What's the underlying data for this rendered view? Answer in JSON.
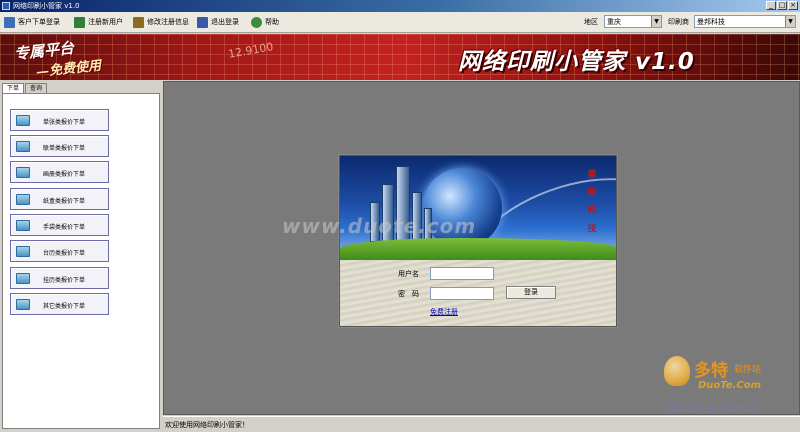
{
  "window": {
    "title": "网络印刷小管家 v1.0",
    "buttons": [
      "_",
      "□",
      "×"
    ]
  },
  "toolbar": {
    "items": [
      {
        "label": "客户下单登录",
        "icon": "client-login-icon",
        "color": "#3b6fb6"
      },
      {
        "label": "注册新用户",
        "icon": "new-user-icon",
        "color": "#2f7f3a"
      },
      {
        "label": "修改注册信息",
        "icon": "edit-info-icon",
        "color": "#8a6b1f"
      },
      {
        "label": "退出登录",
        "icon": "logout-icon",
        "color": "#3a58a8"
      },
      {
        "label": "帮助",
        "icon": "help-icon",
        "color": "#3c8c3c"
      }
    ],
    "region_label": "地区",
    "region_value": "重庆",
    "printer_label": "印刷商",
    "printer_value": "曼邦科技"
  },
  "banner": {
    "slogan_line1": "专属平台",
    "slogan_line2": "—免费使用",
    "deco_text": "12.9100",
    "app_title": "网络印刷小管家 v1.0"
  },
  "left_panel": {
    "tabs": [
      "下单",
      "查询"
    ],
    "items": [
      "单张类报价下单",
      "联单类报价下单",
      "画册类报价下单",
      "纸盒类报价下单",
      "手袋类报价下单",
      "台历类报价下单",
      "挂历类报价下单",
      "其它类报价下单"
    ]
  },
  "login": {
    "brand_vertical": "曼 邦 科 技",
    "watermark": "www.duote.com",
    "username_label": "用户名",
    "username_value": "",
    "password_label": "密　码",
    "password_value": "",
    "login_button": "登录",
    "register_link": "免费注册"
  },
  "status_bar": {
    "text": "欢迎使用网络印刷小管家！"
  },
  "site_watermark": {
    "brand": "多特",
    "brand_suffix": "软件站",
    "url": "DuoTe.Com",
    "tagline": "国内最安全的软件站"
  }
}
